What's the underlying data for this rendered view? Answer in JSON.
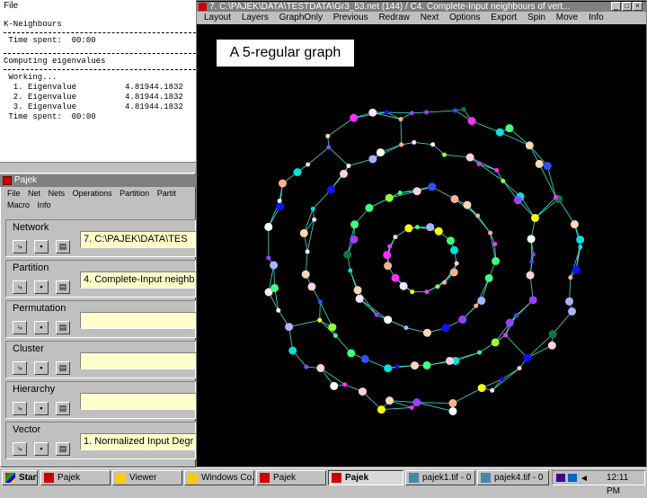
{
  "log": {
    "title": "File",
    "lines": [
      "K-Neighbours",
      "",
      " Time spent:  00:00",
      "",
      "Computing eigenvalues",
      "",
      " Working...",
      "  1. Eigenvalue          4.81944.1832",
      "  2. Eigenvalue          4.81944.1832",
      "  3. Eigenvalue          4.81944.1832",
      " Time spent:  00:00"
    ]
  },
  "pajek": {
    "title": "Pajek",
    "menu_row1": [
      "File",
      "Net",
      "Nets",
      "Operations",
      "Partition",
      "Partit"
    ],
    "menu_row2": [
      "Macro",
      "Info"
    ],
    "sections": [
      {
        "label": "Network",
        "value": "7. C:\\PAJEK\\DATA\\TES"
      },
      {
        "label": "Partition",
        "value": "4. Complete-Input neighb"
      },
      {
        "label": "Permutation",
        "value": ""
      },
      {
        "label": "Cluster",
        "value": ""
      },
      {
        "label": "Hierarchy",
        "value": ""
      },
      {
        "label": "Vector",
        "value": "1. Normalized Input Degr"
      }
    ]
  },
  "graph": {
    "title": "7. C:\\PAJEK\\DATA\\TESTDATA\\Gr3_53.net (144) / C4. Complete-Input neighbours of vert...",
    "menu": [
      "Layout",
      "Layers",
      "GraphOnly",
      "Previous",
      "Redraw",
      "Next",
      "Options",
      "Export",
      "Spin",
      "Move",
      "Info"
    ],
    "caption": "A 5-regular graph",
    "colors": {
      "background": "#000000",
      "edge": "#40e0d0"
    }
  },
  "taskbar": {
    "start": "Start",
    "buttons": [
      "Pajek",
      "Viewer",
      "Windows Co...",
      "Pajek",
      "Pajek",
      "pajek1.tif - 0",
      "pajek4.tif - 0"
    ],
    "time": "12:11 PM"
  }
}
